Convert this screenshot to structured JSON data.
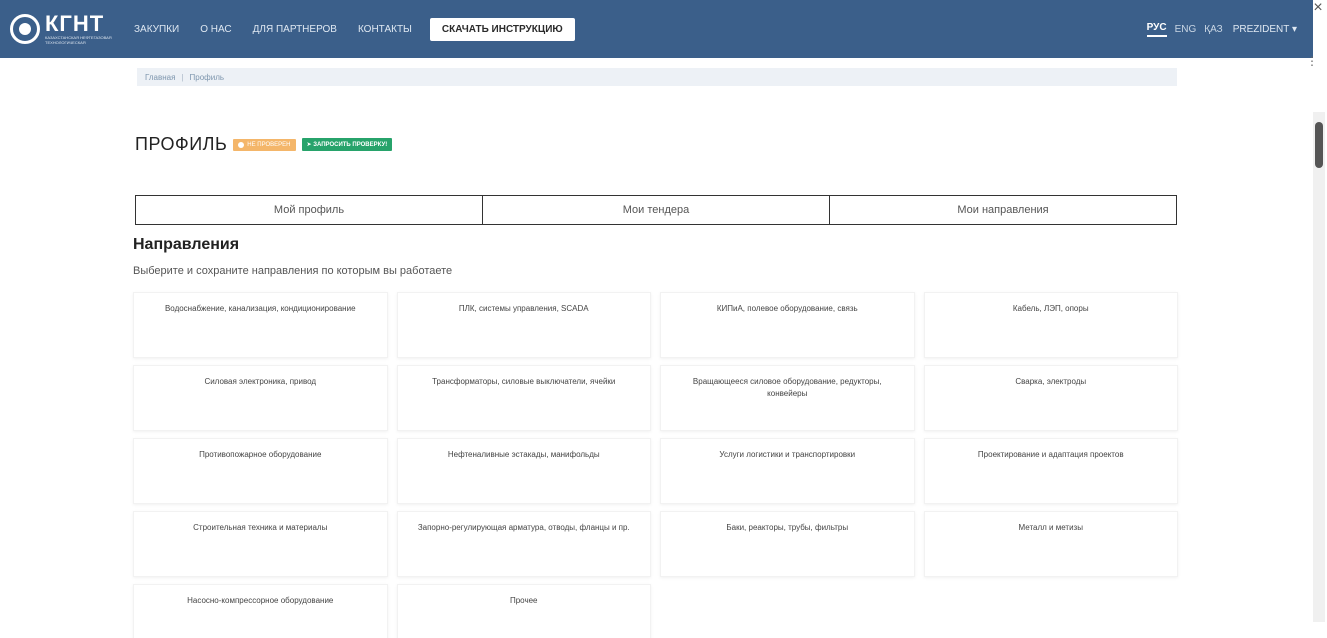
{
  "header": {
    "logo_title": "КГНТ",
    "logo_subtitle": "КАЗАХСТАНСКАЯ НЕФТЕГАЗОВАЯ ТЕХНОЛОГИЧЕСКАЯ",
    "nav": [
      "ЗАКУПКИ",
      "О НАС",
      "ДЛЯ ПАРТНЕРОВ",
      "КОНТАКТЫ"
    ],
    "cta_label": "СКАЧАТЬ ИНСТРУКЦИЮ",
    "languages": [
      "РУС",
      "ENG",
      "ҚАЗ"
    ],
    "user_label": "PREZIDENT"
  },
  "window": {
    "close": "×",
    "more": "⋮"
  },
  "breadcrumb": {
    "home": "Главная",
    "separator": "|",
    "current": "Профиль"
  },
  "page": {
    "title": "ПРОФИЛЬ",
    "status_badge": "НЕ ПРОВЕРЕН",
    "request_button": "ЗАПРОСИТЬ ПРОВЕРКУ!"
  },
  "tabs": [
    "Мой профиль",
    "Мои тендера",
    "Мои направления"
  ],
  "directions": {
    "title": "Направления",
    "subtitle": "Выберите и сохраните направления по которым вы работаете",
    "items": [
      "Водоснабжение, канализация, кондиционирование",
      "ПЛК, системы управления, SCADA",
      "КИПиА, полевое оборудование, связь",
      "Кабель, ЛЭП, опоры",
      "Силовая электроника, привод",
      "Трансформаторы, силовые выключатели, ячейки",
      "Вращающееся силовое оборудование, редукторы, конвейеры",
      "Сварка, электроды",
      "Противопожарное оборудование",
      "Нефтеналивные эстакады, манифольды",
      "Услуги логистики и транспортировки",
      "Проектирование и адаптация проектов",
      "Строительная техника и материалы",
      "Запорно-регулирующая арматура, отводы, фланцы и пр.",
      "Баки, реакторы, трубы, фильтры",
      "Металл и метизы",
      "Насосно-компрессорное оборудование",
      "Прочее"
    ]
  },
  "colors": {
    "navbar": "#3b5f8a",
    "warn": "#f4b66a",
    "success": "#27a36b"
  }
}
